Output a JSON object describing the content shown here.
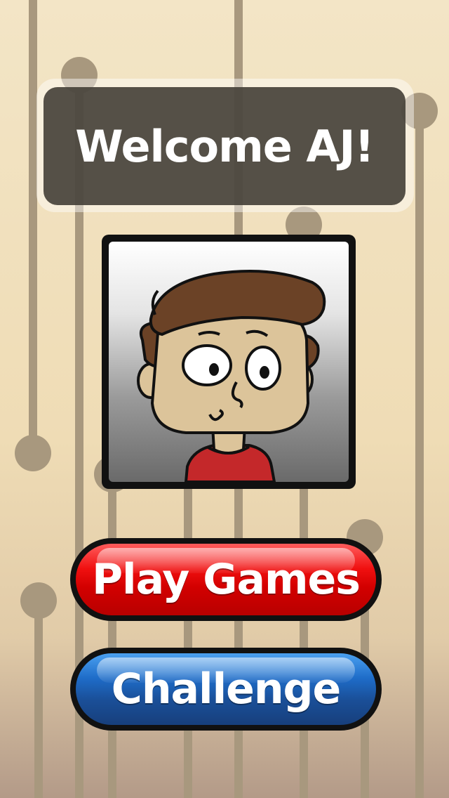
{
  "header": {
    "welcome_text": "Welcome AJ!"
  },
  "avatar": {
    "icon": "cartoon-boy-avatar"
  },
  "buttons": {
    "play_games_label": "Play Games",
    "challenge_label": "Challenge"
  },
  "colors": {
    "background": "#f3e5c6",
    "welcome_box": "#433e36",
    "play_button": "#e00000",
    "challenge_button": "#1e5cb0",
    "decor_lines": "#a8987e"
  }
}
